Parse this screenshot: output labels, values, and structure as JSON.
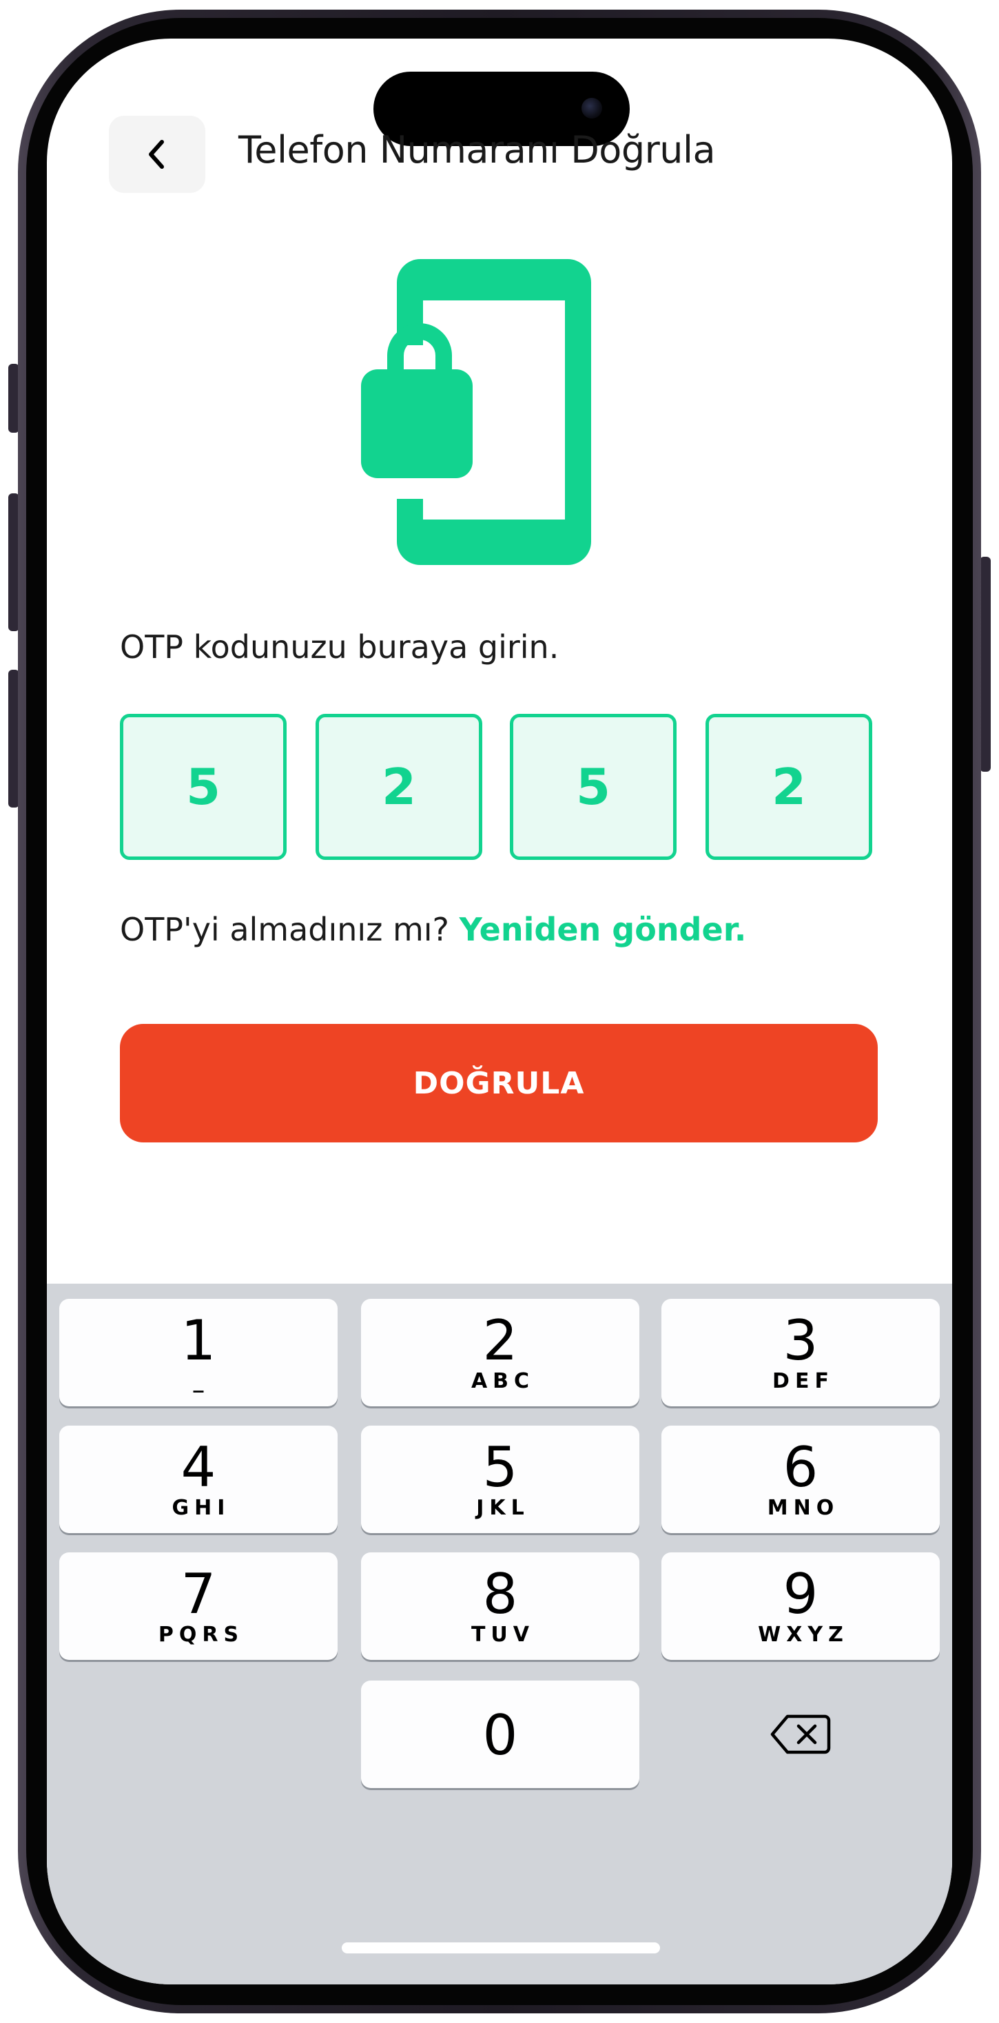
{
  "header": {
    "back_icon": "chevron-left-icon",
    "title": "Telefon Numaranı Doğrula"
  },
  "illustration": {
    "icon": "phone-lock-icon",
    "color": "#12d38f"
  },
  "otp": {
    "prompt": "OTP kodunuzu buraya girin.",
    "digits": [
      "5",
      "2",
      "5",
      "2"
    ],
    "resend_question": "OTP'yi almadınız mı?",
    "resend_link": "Yeniden gönder."
  },
  "verify_button": {
    "label": "DOĞRULA",
    "color": "#ee4424"
  },
  "keypad": {
    "keys": [
      {
        "digit": "1",
        "letters": "_"
      },
      {
        "digit": "2",
        "letters": "ABC"
      },
      {
        "digit": "3",
        "letters": "DEF"
      },
      {
        "digit": "4",
        "letters": "GHI"
      },
      {
        "digit": "5",
        "letters": "JKL"
      },
      {
        "digit": "6",
        "letters": "MNO"
      },
      {
        "digit": "7",
        "letters": "PQRS"
      },
      {
        "digit": "8",
        "letters": "TUV"
      },
      {
        "digit": "9",
        "letters": "WXYZ"
      },
      {
        "digit": "0",
        "letters": ""
      }
    ],
    "delete_icon": "backspace-icon"
  },
  "colors": {
    "accent": "#12d38f",
    "otp_box_fill": "#e8faf3",
    "keypad_background": "#d1d4d9"
  }
}
